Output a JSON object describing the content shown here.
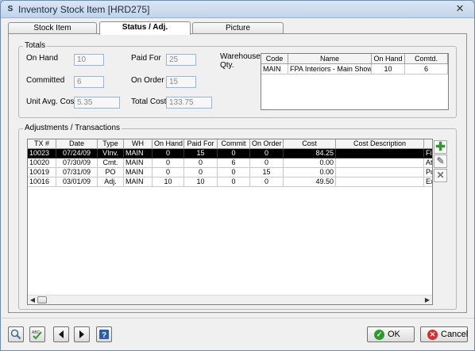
{
  "window": {
    "title": "Inventory Stock Item [HRD275]",
    "app_icon": "S"
  },
  "tabs": [
    {
      "label": "Stock Item"
    },
    {
      "label": "Status / Adj."
    },
    {
      "label": "Picture"
    }
  ],
  "totals": {
    "title": "Totals",
    "on_hand_label": "On Hand",
    "on_hand": "10",
    "paid_for_label": "Paid For",
    "paid_for": "25",
    "committed_label": "Committed",
    "committed": "6",
    "on_order_label": "On Order",
    "on_order": "15",
    "unit_avg_cost_label": "Unit Avg. Cost",
    "unit_avg_cost": "5.35",
    "total_cost_label": "Total Cost",
    "total_cost": "133.75"
  },
  "warehouse": {
    "label": "Warehouse Qty.",
    "columns": [
      "Code",
      "Name",
      "On Hand",
      "Comtd."
    ],
    "rows": [
      {
        "code": "MAIN",
        "name": "FPA Interiors - Main Showro",
        "on_hand": "10",
        "comtd": "6"
      }
    ]
  },
  "adjustments": {
    "title": "Adjustments / Transactions",
    "columns": [
      "TX #",
      "Date",
      "Type",
      "WH",
      "On Hand",
      "Paid For",
      "Commit",
      "On Order",
      "Cost",
      "Cost Description",
      ""
    ],
    "rows": [
      {
        "tx": "10023",
        "date": "07/24/09",
        "type": "VInv.",
        "wh": "MAIN",
        "on_hand": "0",
        "paid_for": "15",
        "commit": "0",
        "on_order": "0",
        "cost": "84.25",
        "desc": "",
        "extra": "Fir"
      },
      {
        "tx": "10020",
        "date": "07/30/09",
        "type": "Cmt.",
        "wh": "MAIN",
        "on_hand": "0",
        "paid_for": "0",
        "commit": "6",
        "on_order": "0",
        "cost": "0.00",
        "desc": "",
        "extra": "Att"
      },
      {
        "tx": "10019",
        "date": "07/31/09",
        "type": "PO",
        "wh": "MAIN",
        "on_hand": "0",
        "paid_for": "0",
        "commit": "0",
        "on_order": "15",
        "cost": "0.00",
        "desc": "",
        "extra": "Pu"
      },
      {
        "tx": "10016",
        "date": "03/01/09",
        "type": "Adj.",
        "wh": "MAIN",
        "on_hand": "10",
        "paid_for": "10",
        "commit": "0",
        "on_order": "0",
        "cost": "49.50",
        "desc": "",
        "extra": "Ex"
      }
    ]
  },
  "side_buttons": [
    "add-icon",
    "edit-pencil-icon",
    "delete-x-icon"
  ],
  "toolbar": {
    "ok_label": "OK",
    "cancel_label": "Cancel",
    "icons": [
      "search-icon",
      "spellcheck-icon",
      "prev-arrow-icon",
      "next-arrow-icon",
      "help-icon"
    ]
  },
  "colors": {
    "selected_row": "#000000",
    "add_green": "#2e9a2e",
    "cancel_red": "#d03030",
    "ok_green": "#2e9a2e"
  }
}
